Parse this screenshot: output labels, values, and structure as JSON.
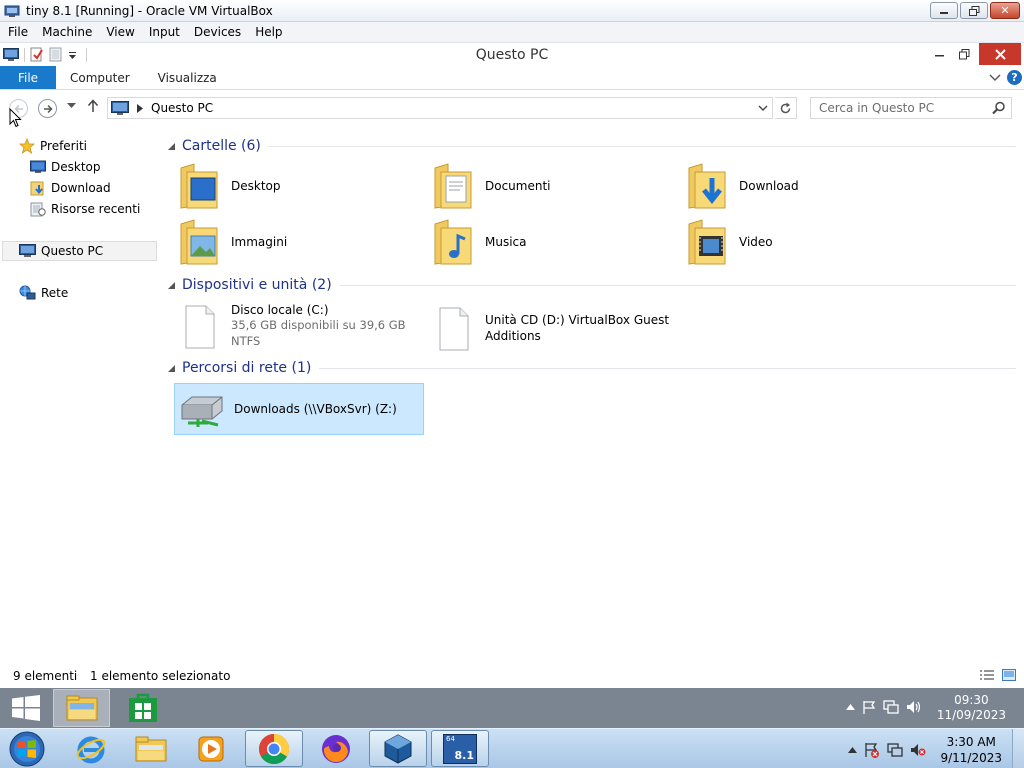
{
  "host_window": {
    "title": "tiny 8.1 [Running] - Oracle VM VirtualBox",
    "menus": [
      "File",
      "Machine",
      "View",
      "Input",
      "Devices",
      "Help"
    ],
    "controls": {
      "minimize": "▭",
      "maximize": "❐",
      "close": "✕"
    }
  },
  "explorer": {
    "title": "Questo PC",
    "ribbon": {
      "tabs": [
        "File",
        "Computer",
        "Visualizza"
      ]
    },
    "address": {
      "path": "Questo PC",
      "search_placeholder": "Cerca in Questo PC"
    },
    "nav_pane": {
      "favorites_label": "Preferiti",
      "favorites": [
        "Desktop",
        "Download",
        "Risorse recenti"
      ],
      "this_pc": "Questo PC",
      "network": "Rete"
    },
    "groups": {
      "folders": {
        "header": "Cartelle (6)",
        "items": [
          "Desktop",
          "Documenti",
          "Download",
          "Immagini",
          "Musica",
          "Video"
        ]
      },
      "devices": {
        "header": "Dispositivi e unità (2)",
        "local_disk": {
          "name": "Disco locale (C:)",
          "free": "35,6 GB disponibili su 39,6 GB",
          "fs": "NTFS"
        },
        "cd_drive": {
          "name_line1": "Unità CD (D:) VirtualBox Guest",
          "name_line2": "Additions"
        }
      },
      "network": {
        "header": "Percorsi di rete (1)",
        "share": "Downloads (\\\\VBoxSvr) (Z:)"
      }
    },
    "status": {
      "items": "9 elementi",
      "selected": "1 elemento selezionato"
    }
  },
  "guest_taskbar": {
    "clock_time": "09:30",
    "clock_date": "11/09/2023"
  },
  "host_taskbar": {
    "clock_time": "3:30 AM",
    "clock_date": "9/11/2023",
    "vm_badge": "8.1",
    "vm_badge_top": "64"
  },
  "colors": {
    "accent_blue": "#1979ca",
    "group_header": "#1e3287",
    "selection": "#cce8ff",
    "close_red": "#c7382b"
  }
}
